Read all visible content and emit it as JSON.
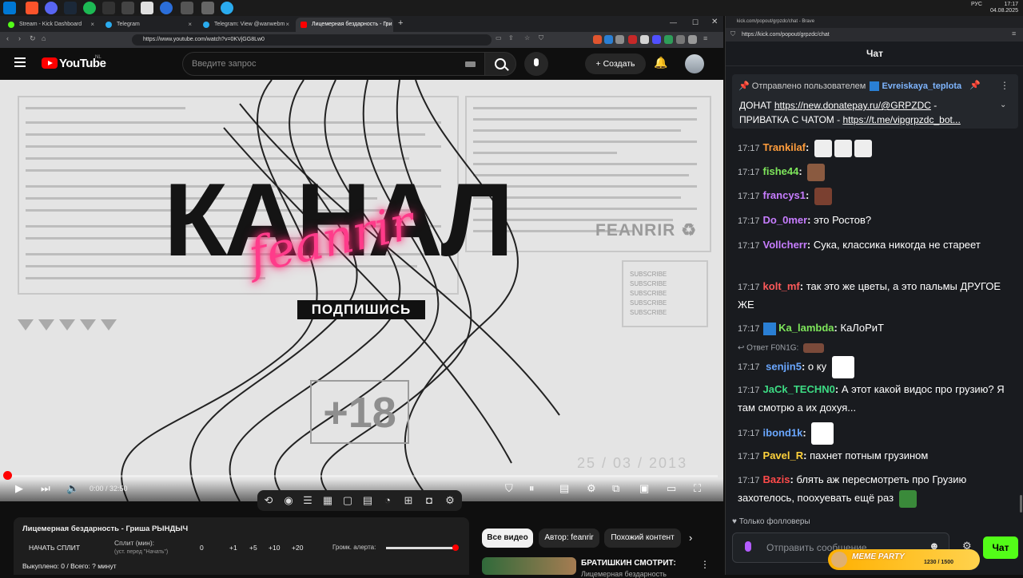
{
  "taskbar": {
    "time": "17:17",
    "date": "04.08.2025",
    "lang": "РУС"
  },
  "browser": {
    "tabs": [
      {
        "title": "Stream - Kick Dashboard",
        "color": "#53fc18"
      },
      {
        "title": "Telegram",
        "color": "#2aabee"
      },
      {
        "title": "Telegram: View @wanwebm",
        "color": "#2aabee"
      },
      {
        "title": "Лицемерная бездарность - Гри",
        "color": "#ff0000"
      }
    ],
    "new_tab_icon": "+",
    "url": "https://www.youtube.com/watch?v=0KVjGG8Lw0"
  },
  "youtube": {
    "logo_text": "YouTube",
    "country": "NL",
    "search_placeholder": "Введите запрос",
    "create_label": "Создать",
    "video": {
      "big_title": "КАНАЛ",
      "neon_text": "feanrir",
      "subscribe_text": "ПОДПИШИСЬ",
      "brand": "FEANRIR",
      "age": "+18",
      "date_overlay": "25 / 03 / 2013",
      "subscribe_list": [
        "SUBSCRIBE",
        "SUBSCRIBE",
        "SUBSCRIBE",
        "SUBSCRIBE",
        "SUBSCRIBE",
        "SUBSCRIBE"
      ],
      "time": "0:00 / 32:50",
      "progress": 0
    },
    "chips": [
      "Все видео",
      "Автор: feanrir",
      "Похожий контент"
    ],
    "related": {
      "title": "БРАТИШКИН СМОТРИТ:",
      "subtitle": "Лицемерная бездарность"
    }
  },
  "split": {
    "title": "Лицемерная бездарность - Гриша РЫНДЫЧ",
    "start_label": "НАЧАТЬ СПЛИТ",
    "split_label": "Сплит (мин):",
    "split_hint": "(уст. перед \"Начать\")",
    "split_value": "0",
    "increments": [
      "+1",
      "+5",
      "+10",
      "+20"
    ],
    "alert_label": "Громк. алерта:",
    "alert_volume": 1.0,
    "bought": "Выкуплено: 0 / Всего: ? минут"
  },
  "kick": {
    "window_title": "kick.com/popout/grpzdc/chat - Brave",
    "url": "https://kick.com/popout/grpzdc/chat",
    "chat_title": "Чат",
    "pinned": {
      "by_label": "Отправлено пользователем",
      "user": "Evreiskaya_teplota",
      "text1": "ДОНАТ ",
      "link1": "https://new.donatepay.ru/@GRPZDC",
      "text2": " -",
      "text3": "ПРИВАТКА С ЧАТОМ - ",
      "link2": "https://t.me/vipgrpzdc_bot..."
    },
    "messages": [
      {
        "ts": "17:17",
        "user": "Trankilaf",
        "color": "#ff9d3c",
        "text": ""
      },
      {
        "ts": "17:17",
        "user": "fishe44",
        "color": "#7ee65b",
        "text": ""
      },
      {
        "ts": "17:17",
        "user": "francys1",
        "color": "#c77dff",
        "text": ""
      },
      {
        "ts": "17:17",
        "user": "Do_0mer",
        "color": "#c77dff",
        "text": "это Ростов?"
      },
      {
        "ts": "17:17",
        "user": "Vollcherr",
        "color": "#c77dff",
        "text": "Сука, классика никогда не стареет"
      },
      {
        "ts": "17:17",
        "user": "kolt_mf",
        "color": "#ff5a5a",
        "text": "так это же цветы, а это пальмы ДРУГОЕ ЖЕ"
      },
      {
        "ts": "17:17",
        "user": "Ka_lambda",
        "color": "#7ee65b",
        "text": "КаЛоРиТ"
      },
      {
        "ts": "17:17",
        "user": "senjin5",
        "color": "#6aa7ff",
        "text": "о ку",
        "reply": "Ответ F0N1G:"
      },
      {
        "ts": "17:17",
        "user": "JaCk_TECHN0",
        "color": "#3ddc84",
        "text": "А этот какой видос про грузию? Я там смотрю а их дохуя..."
      },
      {
        "ts": "17:17",
        "user": "ibond1k",
        "color": "#6aa7ff",
        "text": ""
      },
      {
        "ts": "17:17",
        "user": "Pavel_R",
        "color": "#ffd23c",
        "text": "пахнет потным грузином"
      },
      {
        "ts": "17:17",
        "user": "Bazis",
        "color": "#ff4a4a",
        "text": "блять аж пересмотреть про Грузию захотелось, поохуевать ещё раз"
      }
    ],
    "followers_only": "Только фолловеры",
    "input_placeholder": "Отправить сообщение",
    "send_label": "Чат",
    "meme_party": {
      "label": "MEME PARTY",
      "progress": "1230 / 1500"
    }
  }
}
